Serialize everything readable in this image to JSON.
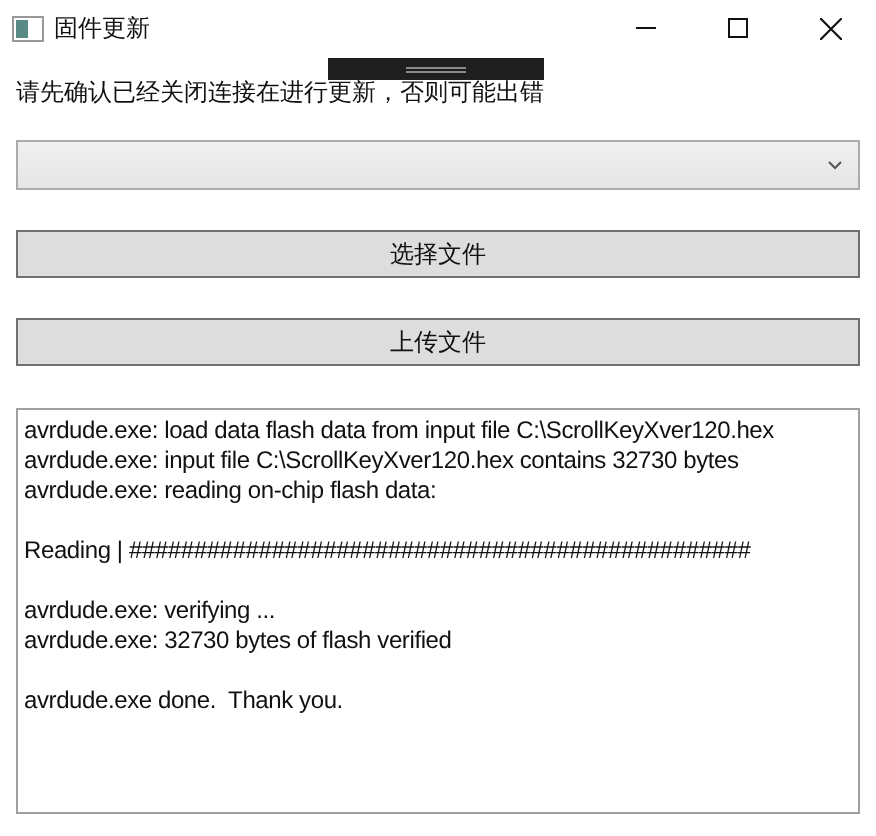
{
  "window": {
    "title": "固件更新"
  },
  "notice": "请先确认已经关闭连接在进行更新，否则可能出错",
  "buttons": [
    {
      "label": "选择文件"
    },
    {
      "label": "上传文件"
    }
  ],
  "log": [
    [
      "avrdude.exe: load data flash data from input file C:\\ScrollKeyXver120.hex",
      "avrdude.exe: input file C:\\ScrollKeyXver120.hex contains 32730 bytes",
      "avrdude.exe: reading on-chip flash data:"
    ],
    [
      "Reading | ################################################"
    ],
    [
      "avrdude.exe: verifying ...",
      "avrdude.exe: 32730 bytes of flash verified"
    ],
    [
      "avrdude.exe done.  Thank you."
    ]
  ]
}
